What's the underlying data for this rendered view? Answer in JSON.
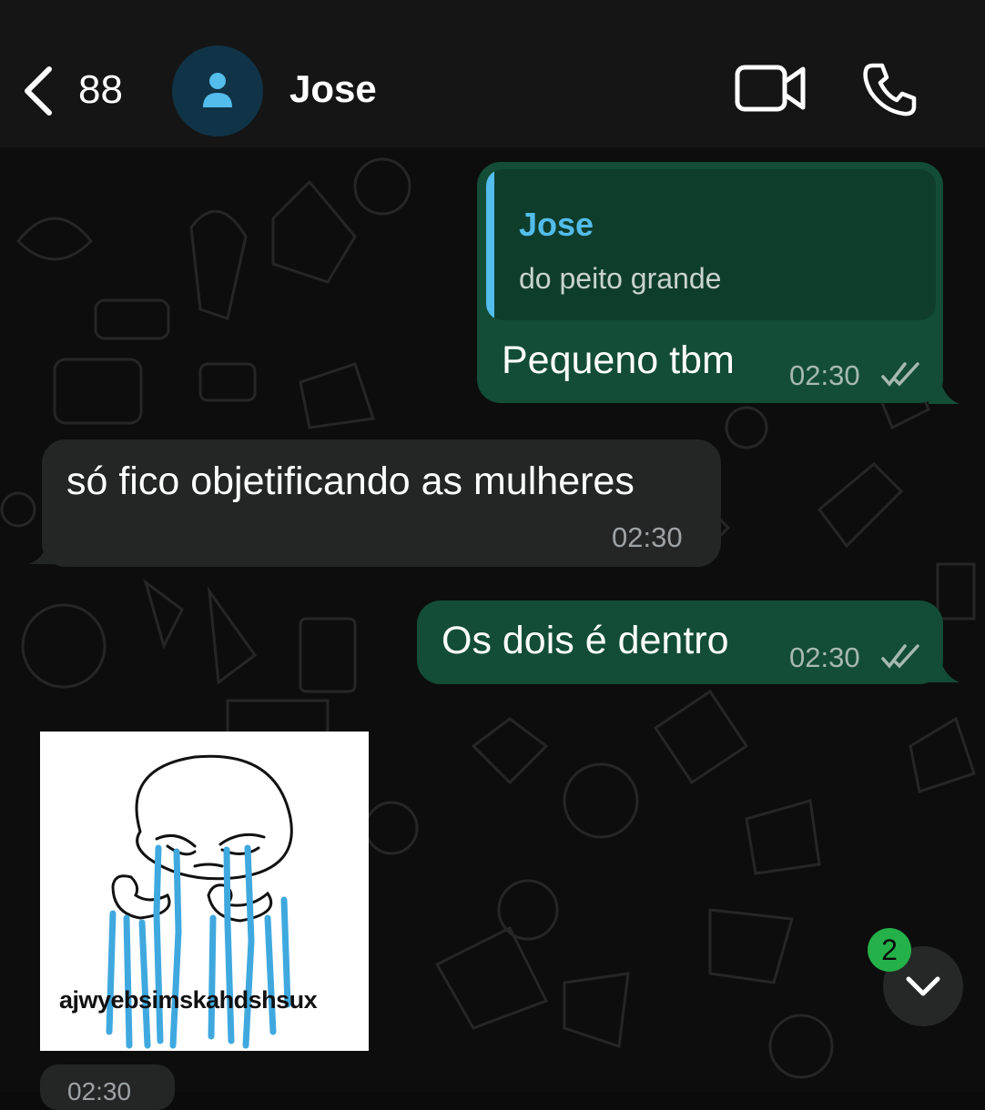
{
  "header": {
    "back_count": "88",
    "contact_name": "Jose"
  },
  "messages": [
    {
      "direction": "outgoing",
      "quote": {
        "author": "Jose",
        "text": "do peito grande"
      },
      "text": "Pequeno tbm",
      "time": "02:30",
      "status": "read"
    },
    {
      "direction": "incoming",
      "text": "só fico objetificando as mulheres",
      "time": "02:30"
    },
    {
      "direction": "outgoing",
      "text": "Os dois é dentro",
      "time": "02:30",
      "status": "read"
    },
    {
      "direction": "incoming",
      "type": "sticker",
      "caption": "ajwyebsimskahdshsux",
      "time": "02:30"
    }
  ],
  "scroll_button": {
    "unread_count": "2"
  },
  "colors": {
    "outgoing_bubble": "#134d37",
    "incoming_bubble": "#242626",
    "accent_blue": "#53bdeb",
    "badge_green": "#25b14a"
  },
  "icons": [
    "back-chevron-icon",
    "person-icon",
    "video-camera-icon",
    "phone-icon",
    "double-check-icon",
    "chevron-down-icon"
  ]
}
